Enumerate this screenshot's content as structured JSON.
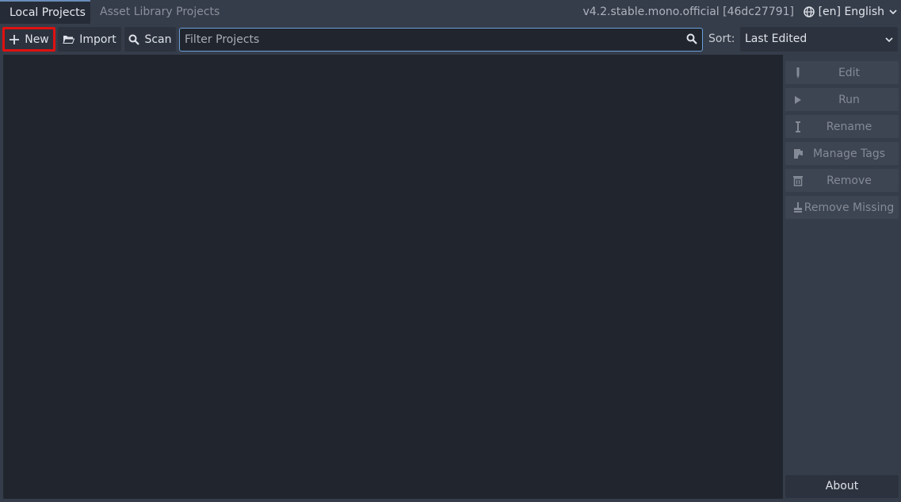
{
  "tabs": {
    "local": "Local Projects",
    "asset_library": "Asset Library Projects"
  },
  "version": "v4.2.stable.mono.official [46dc27791]",
  "language": {
    "label": "[en] English",
    "icon": "globe-icon"
  },
  "toolbar": {
    "new_label": "New",
    "import_label": "Import",
    "scan_label": "Scan"
  },
  "filter": {
    "placeholder": "Filter Projects",
    "value": ""
  },
  "sort": {
    "label": "Sort:",
    "selected": "Last Edited"
  },
  "side_actions": [
    {
      "label": "Edit",
      "icon": "pencil-icon"
    },
    {
      "label": "Run",
      "icon": "play-icon"
    },
    {
      "label": "Rename",
      "icon": "text-cursor-icon"
    },
    {
      "label": "Manage Tags",
      "icon": "tag-icon"
    },
    {
      "label": "Remove",
      "icon": "trash-icon"
    },
    {
      "label": "Remove Missing",
      "icon": "broom-icon"
    }
  ],
  "about_label": "About",
  "colors": {
    "background": "#363d4a",
    "list_background": "#21262e",
    "accent": "#6aa0dc",
    "highlight": "#e01010"
  }
}
